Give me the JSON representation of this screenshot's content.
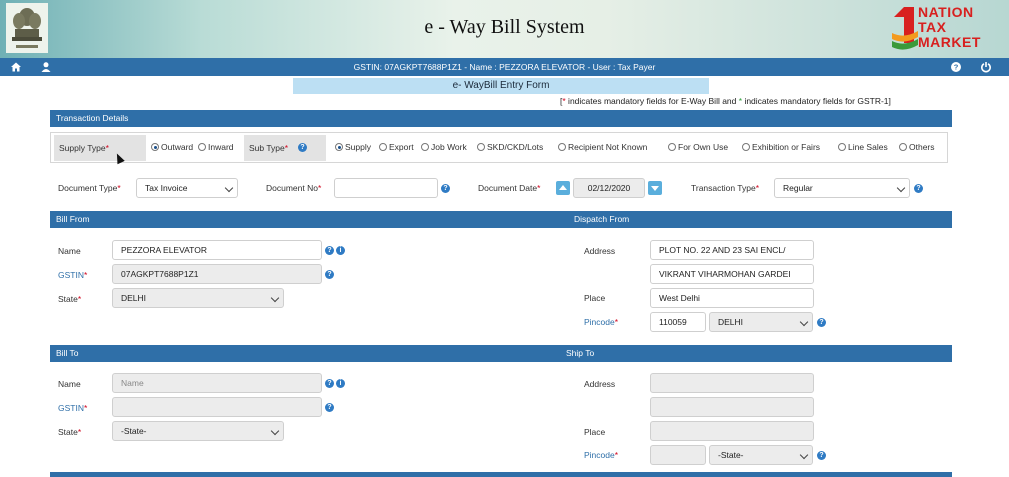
{
  "banner": {
    "title": "e - Way Bill System",
    "logo_text": [
      "NATION",
      "TAX",
      "MARKET"
    ]
  },
  "nav": {
    "info": "GSTIN: 07AGKPT7688P1Z1 - Name : PEZZORA ELEVATOR - User : Tax Payer"
  },
  "form": {
    "title": "e- WayBill Entry Form",
    "note_part1": " indicates mandatory fields for E-Way Bill and ",
    "note_part2": " indicates mandatory fields for GSTR-1"
  },
  "sections": {
    "transaction": "Transaction Details",
    "bill_from": "Bill From",
    "dispatch_from": "Dispatch From",
    "bill_to": "Bill To",
    "ship_to": "Ship To"
  },
  "supply": {
    "label": "Supply Type",
    "options": [
      "Outward",
      "Inward"
    ],
    "selected": "Outward"
  },
  "subtype": {
    "label": "Sub Type",
    "options": [
      "Supply",
      "Export",
      "Job Work",
      "SKD/CKD/Lots",
      "Recipient Not Known",
      "For Own Use",
      "Exhibition or Fairs",
      "Line Sales",
      "Others"
    ],
    "selected": "Supply"
  },
  "doc": {
    "type_label": "Document Type",
    "type_value": "Tax Invoice",
    "no_label": "Document No",
    "no_value": "",
    "date_label": "Document Date",
    "date_value": "02/12/2020",
    "trans_label": "Transaction Type",
    "trans_value": "Regular"
  },
  "bill_from": {
    "name_label": "Name",
    "name_value": "PEZZORA ELEVATOR",
    "gstin_label": "GSTIN",
    "gstin_value": "07AGKPT7688P1Z1",
    "state_label": "State",
    "state_value": "DELHI"
  },
  "dispatch_from": {
    "address_label": "Address",
    "address1": "PLOT NO. 22 AND  23 SAI ENCL/",
    "address2": "VIKRANT VIHARMOHAN GARDEI",
    "place_label": "Place",
    "place_value": "West Delhi",
    "pincode_label": "Pincode",
    "pincode_value": "110059",
    "state_value": "DELHI"
  },
  "bill_to": {
    "name_label": "Name",
    "name_placeholder": "Name",
    "gstin_label": "GSTIN",
    "gstin_value": "",
    "state_label": "State",
    "state_value": "-State-"
  },
  "ship_to": {
    "address_label": "Address",
    "address1": "",
    "address2": "",
    "place_label": "Place",
    "place_value": "",
    "pincode_label": "Pincode",
    "pincode_value": "",
    "state_value": "-State-"
  },
  "colors": {
    "nav_blue": "#2f6fa8",
    "title_bar": "#bcdff3",
    "required": "#d0021b",
    "gstr_mark": "#2e9d3a"
  }
}
